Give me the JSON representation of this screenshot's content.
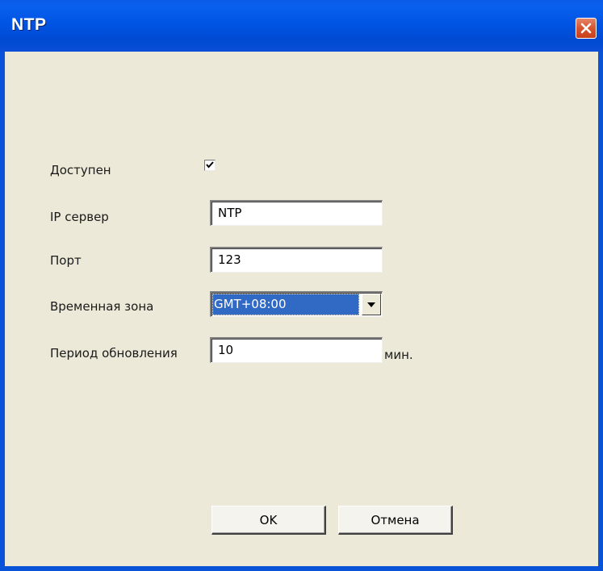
{
  "window": {
    "title": "NTP"
  },
  "form": {
    "enabled_label": "Доступен",
    "enabled_checked": true,
    "ip_server_label": "IP сервер",
    "ip_server_value": "NTP",
    "port_label": "Порт",
    "port_value": "123",
    "timezone_label": "Временная зона",
    "timezone_value": "GMT+08:00",
    "update_period_label": "Период обновления",
    "update_period_value": "10",
    "update_period_unit": "мин."
  },
  "buttons": {
    "ok_label": "OK",
    "cancel_label": "Отмена"
  },
  "icons": {
    "close": "close-icon",
    "checkmark": "checkmark-icon",
    "dropdown": "chevron-down-icon"
  },
  "colors": {
    "titlebar": "#0054e3",
    "dialog_bg": "#ece9d8",
    "selection": "#316ac5",
    "close_button": "#d8542f"
  }
}
